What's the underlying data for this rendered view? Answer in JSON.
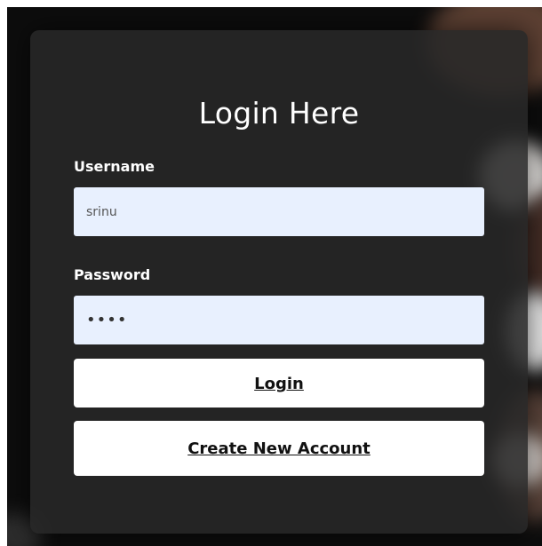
{
  "login_form": {
    "title": "Login Here",
    "username_label": "Username",
    "username_value": "srinu",
    "password_label": "Password",
    "password_value": "••••",
    "login_button": "Login",
    "create_account_button": "Create New Account"
  },
  "colors": {
    "card_background": "#282828",
    "input_background": "#e8f0fe",
    "button_background": "#ffffff",
    "text_light": "#ffffff"
  }
}
